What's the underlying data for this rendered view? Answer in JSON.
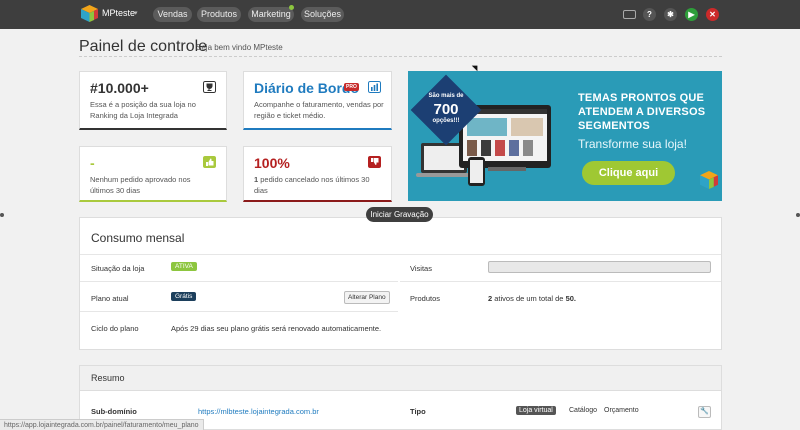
{
  "topbar": {
    "store_name": "MPteste",
    "nav": [
      "Vendas",
      "Produtos",
      "Marketing",
      "Soluções"
    ],
    "icons": [
      "screen-icon",
      "help-icon",
      "gear-icon",
      "play-icon",
      "close-icon"
    ],
    "colors": {
      "bar": "#3e3e3e",
      "play": "#2e9e3a",
      "close": "#cc2a2a",
      "marketing_dot": "#8dc63f"
    }
  },
  "header": {
    "title": "Painel de controle",
    "subtitle": "Seja bem vindo MPteste"
  },
  "cards": [
    {
      "value": "#10.000+",
      "desc": "Essa é a posição da sua loja no Ranking da Loja Integrada",
      "icon": "trophy-icon"
    },
    {
      "value": "Diário de Bordo",
      "badge": "PRO",
      "desc": "Acompanhe o faturamento, vendas por região e ticket médio.",
      "icon": "bar-chart-icon"
    },
    {
      "value": "-",
      "desc": "Nenhum pedido aprovado nos últimos 30 dias",
      "icon": "thumbs-up-icon"
    },
    {
      "value": "100%",
      "desc_strong": "1",
      "desc": "pedido cancelado nos últimos 30 dias",
      "icon": "thumbs-down-icon"
    }
  ],
  "banner": {
    "badge_top": "São mais de",
    "badge_number": "700",
    "badge_bottom": "opções!!!",
    "line1": "TEMAS PRONTOS QUE",
    "line2": "ATENDEM A DIVERSOS",
    "line3": "SEGMENTOS",
    "sub": "Transforme sua loja!",
    "button": "Clique aqui"
  },
  "tooltip": "Iniciar Gravação",
  "consumo": {
    "title": "Consumo mensal",
    "situacao_label": "Situação da loja",
    "situacao_value": "ATIVA",
    "plano_label": "Plano atual",
    "plano_value": "Grátis",
    "alterar_plano": "Alterar Plano",
    "ciclo_label": "Ciclo do plano",
    "ciclo_value": "Após 29 dias seu plano grátis será renovado automaticamente.",
    "visitas_label": "Visitas",
    "produtos_label": "Produtos",
    "produtos_count": "2",
    "produtos_mid": "ativos de um total de",
    "produtos_total": "50."
  },
  "resumo": {
    "title": "Resumo",
    "subdominio_label": "Sub-domínio",
    "subdominio_value": "https://mlbteste.lojaintegrada.com.br",
    "tipo_label": "Tipo",
    "tipos": [
      "Loja virtual",
      "Catálogo",
      "Orçamento"
    ]
  },
  "status_url": "https://app.lojaintegrada.com.br/painel/faturamento/meu_plano"
}
